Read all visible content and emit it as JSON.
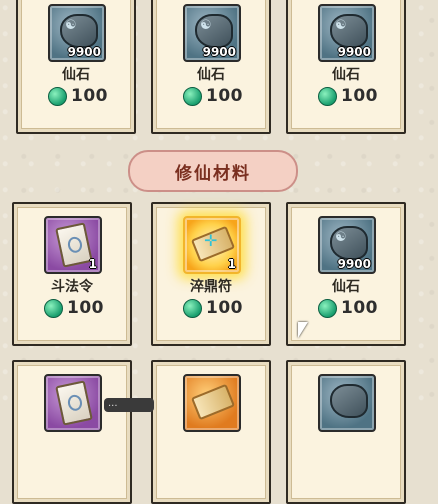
{
  "sections": {
    "materials_title": "修仙材料"
  },
  "row1": [
    {
      "name": "仙石",
      "qty": "9900",
      "price": "100",
      "icon": "spirit-stone-icon"
    },
    {
      "name": "仙石",
      "qty": "9900",
      "price": "100",
      "icon": "spirit-stone-icon"
    },
    {
      "name": "仙石",
      "qty": "9900",
      "price": "100",
      "icon": "spirit-stone-icon"
    }
  ],
  "row2": [
    {
      "name": "斗法令",
      "qty": "1",
      "price": "100",
      "icon": "battle-token-icon"
    },
    {
      "name": "淬鼎符",
      "qty": "1",
      "price": "100",
      "icon": "talisman-icon"
    },
    {
      "name": "仙石",
      "qty": "9900",
      "price": "100",
      "icon": "spirit-stone-icon"
    }
  ],
  "tooltip": "..."
}
